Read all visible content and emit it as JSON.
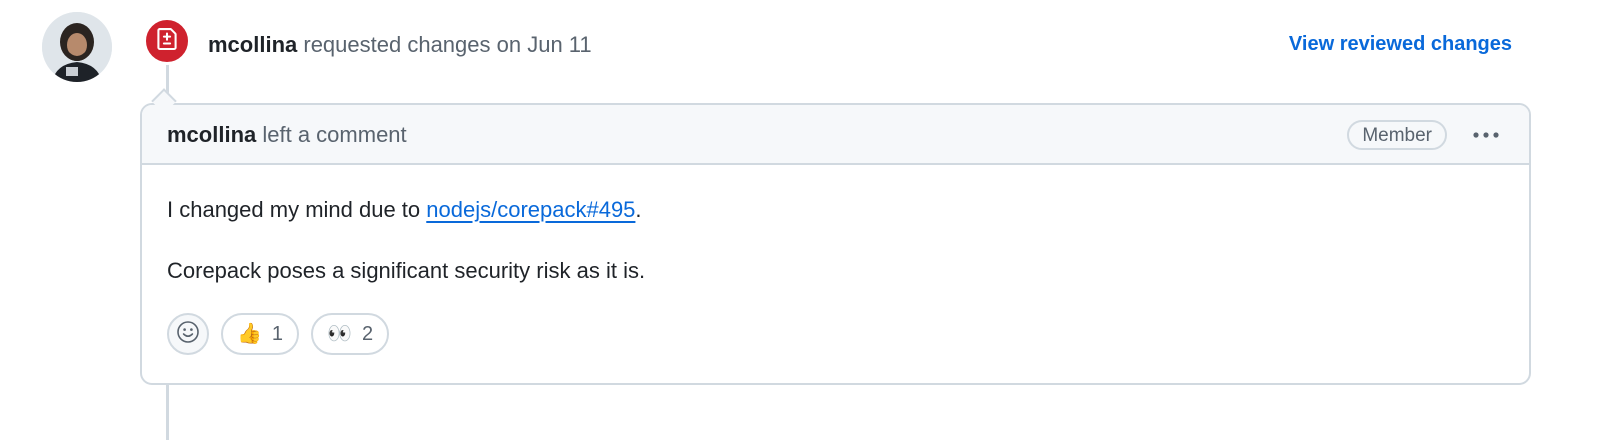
{
  "review": {
    "author": "mcollina",
    "action_text": "requested changes on Jun 11",
    "view_changes_label": "View reviewed changes"
  },
  "comment": {
    "author": "mcollina",
    "action_text": "left a comment",
    "role_badge": "Member",
    "more_options_label": "···",
    "body": {
      "line1_prefix": "I changed my mind due to ",
      "link_text": "nodejs/corepack#495",
      "line1_suffix": ".",
      "line2": "Corepack poses a significant security risk as it is."
    },
    "reactions": [
      {
        "emoji": "👍",
        "icon": "thumbs-up",
        "count": "1"
      },
      {
        "emoji": "👀",
        "icon": "eyes",
        "count": "2"
      }
    ]
  },
  "colors": {
    "accent_link": "#0969da",
    "changes_requested": "#cf222e",
    "border": "#d1d9e0",
    "header_bg": "#f6f8fa"
  },
  "icons": {
    "avatar": "user-avatar",
    "review_state": "file-diff-icon",
    "add_reaction": "smiley-icon",
    "more": "kebab-horizontal-icon"
  }
}
